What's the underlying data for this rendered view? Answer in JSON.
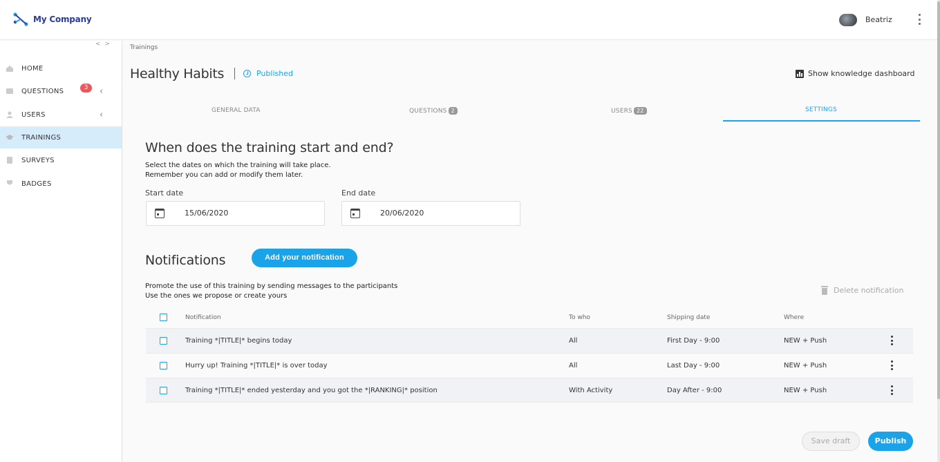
{
  "header": {
    "brand": "My Company",
    "user_name": "Beatriz"
  },
  "sidebar": {
    "items": [
      {
        "label": "HOME",
        "icon": "home-icon"
      },
      {
        "label": "QUESTIONS",
        "icon": "questions-icon",
        "badge": "3"
      },
      {
        "label": "USERS",
        "icon": "users-icon"
      },
      {
        "label": "TRAININGS",
        "icon": "trainings-icon",
        "active": true
      },
      {
        "label": "SURVEYS",
        "icon": "surveys-icon"
      },
      {
        "label": "BADGES",
        "icon": "badges-icon"
      }
    ]
  },
  "page": {
    "breadcrumb": "Trainings",
    "title": "Healthy Habits",
    "status": "Published",
    "dashboard_link": "Show knowledge dashboard"
  },
  "tabs": [
    {
      "label": "GENERAL DATA"
    },
    {
      "label": "QUESTIONS",
      "count": "2"
    },
    {
      "label": "USERS",
      "count": "22"
    },
    {
      "label": "SETTINGS",
      "active": true
    }
  ],
  "dates": {
    "title": "When does the training start and end?",
    "desc_line1": "Select the dates on which the training will take place.",
    "desc_line2": "Remember you can add or modify them later.",
    "start_label": "Start date",
    "start_value": "15/06/2020",
    "end_label": "End date",
    "end_value": "20/06/2020"
  },
  "notifications": {
    "title": "Notifications",
    "add_button": "Add your notification",
    "desc_line1": "Promote the use of this training by sending messages to the participants",
    "desc_line2": "Use the ones we propose or create yours",
    "delete_label": "Delete notification",
    "columns": {
      "notification": "Notification",
      "to_who": "To who",
      "shipping_date": "Shipping date",
      "where": "Where"
    },
    "rows": [
      {
        "notification": "Training *|TITLE|* begins today",
        "to_who": "All",
        "shipping_date": "First Day - 9:00",
        "where": "NEW + Push"
      },
      {
        "notification": "Hurry up! Training *|TITLE|* is over today",
        "to_who": "All",
        "shipping_date": "Last Day - 9:00",
        "where": "NEW + Push"
      },
      {
        "notification": "Training *|TITLE|* ended yesterday and you got the *|RANKING|* position",
        "to_who": "With Activity",
        "shipping_date": "Day After - 9:00",
        "where": "NEW + Push"
      }
    ]
  },
  "footer": {
    "save_draft": "Save draft",
    "publish": "Publish"
  },
  "colors": {
    "accent": "#1aa3e8",
    "brand": "#2a3b9e",
    "badge": "#f2545b",
    "active_nav": "#d6ecfa"
  }
}
